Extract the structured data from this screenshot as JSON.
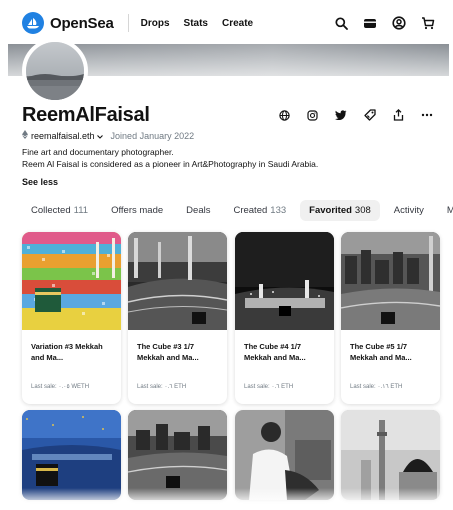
{
  "nav": {
    "brand": "OpenSea",
    "links": [
      "Drops",
      "Stats",
      "Create"
    ],
    "icons": [
      "search-icon",
      "wallet-icon",
      "account-icon",
      "cart-icon"
    ]
  },
  "profile": {
    "name": "ReemAlFaisal",
    "handle": "reemalfaisal.eth",
    "joined": "Joined January 2022",
    "bio_line1": "Fine art and documentary photographer.",
    "bio_line2": "Reem Al Faisal is considered as a pioneer in Art&Photography in Saudi Arabia.",
    "see_less": "See less",
    "action_icons": [
      "globe-icon",
      "instagram-icon",
      "twitter-icon",
      "tag-icon",
      "share-icon",
      "more-icon"
    ]
  },
  "tabs": [
    {
      "label": "Collected",
      "count": "111"
    },
    {
      "label": "Offers made",
      "count": ""
    },
    {
      "label": "Deals",
      "count": ""
    },
    {
      "label": "Created",
      "count": "133"
    },
    {
      "label": "Favorited",
      "count": "308",
      "active": true
    },
    {
      "label": "Activity",
      "count": ""
    },
    {
      "label": "M",
      "count": ""
    }
  ],
  "cards": [
    {
      "title": "Variation #3 Mekkah and Ma...",
      "sale": "Last sale: ٠.٠٥ WETH"
    },
    {
      "title": "The Cube #3 1/7 Mekkah and Ma...",
      "sale": "Last sale: ٠.٦ ETH"
    },
    {
      "title": "The Cube #4 1/7 Mekkah and Ma...",
      "sale": "Last sale: ٠.٦ ETH"
    },
    {
      "title": "The Cube #5 1/7 Mekkah and Ma...",
      "sale": "Last sale: ٠.١٦ ETH"
    }
  ],
  "colors": {
    "accent": "#2081e2",
    "muted": "#707a83",
    "text": "#121212"
  }
}
